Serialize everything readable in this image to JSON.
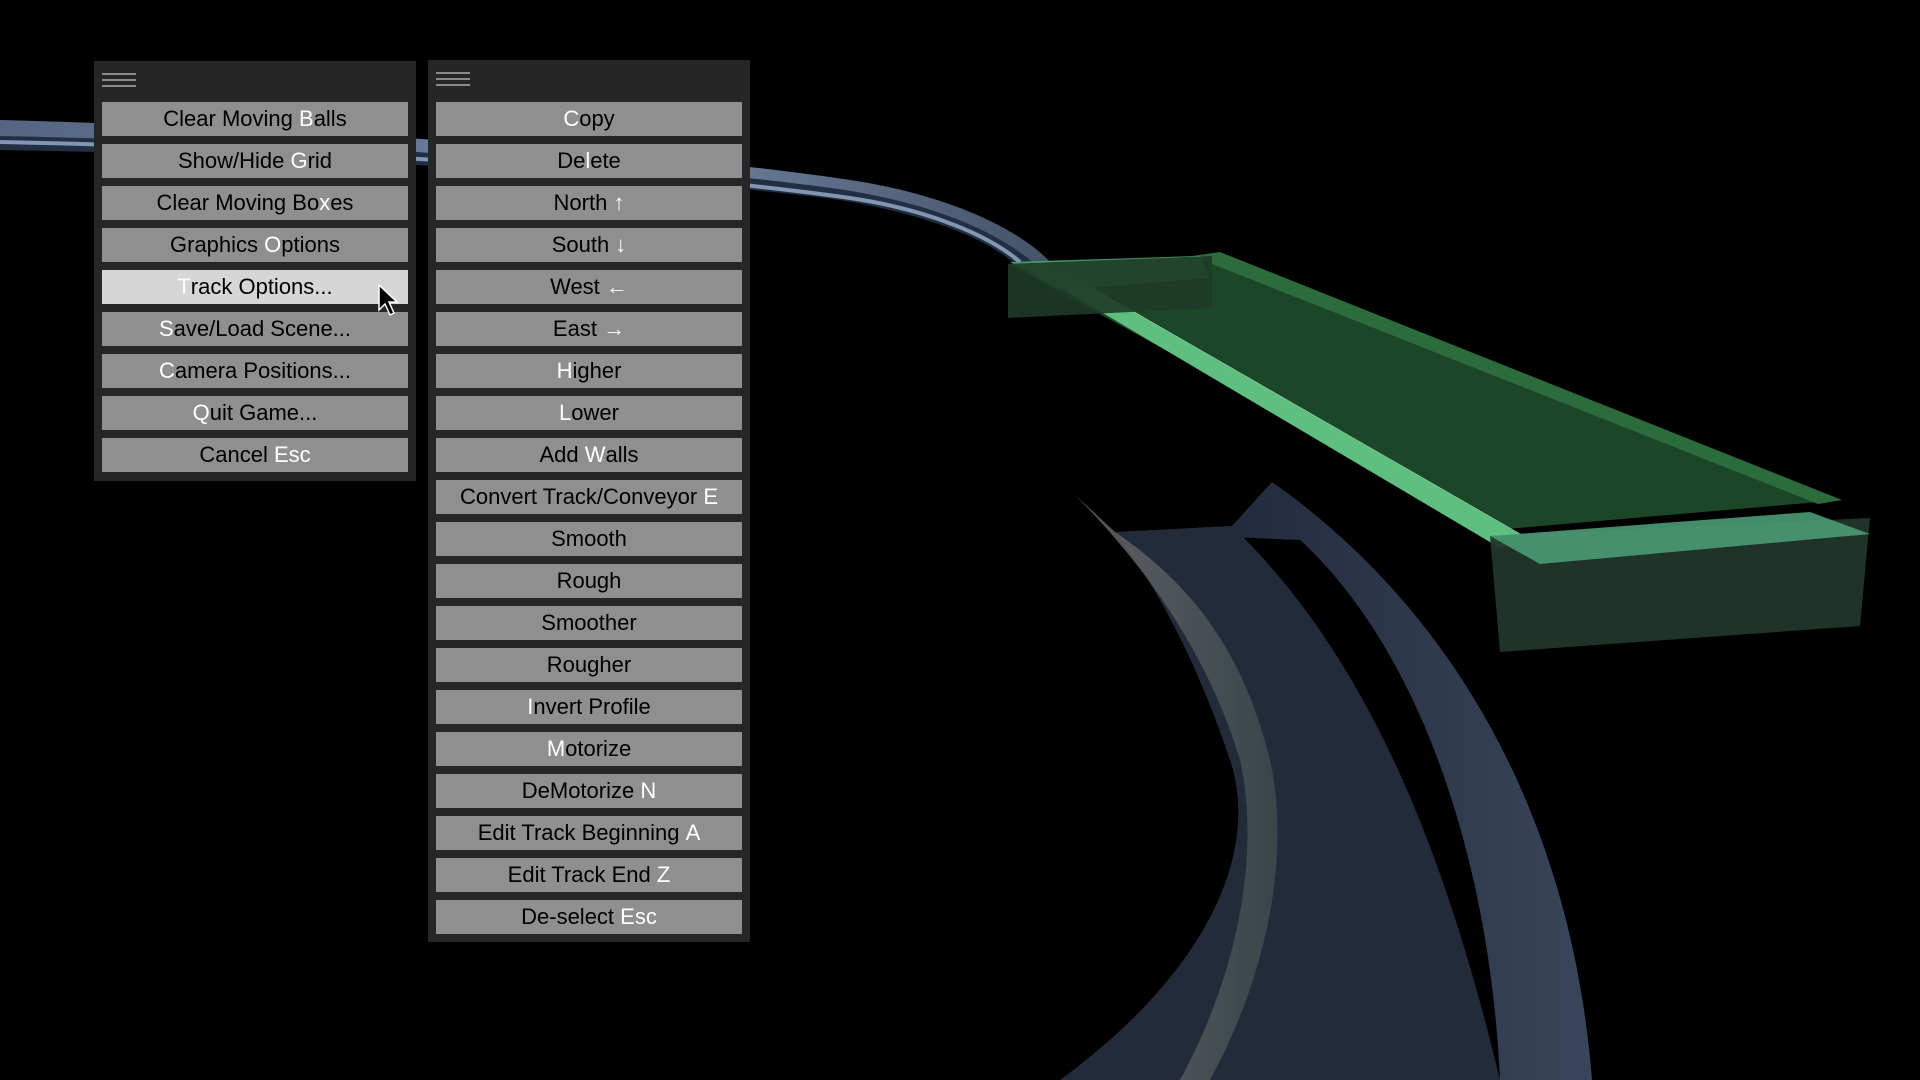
{
  "main_menu": {
    "items": [
      {
        "pre": "Clear Moving ",
        "key": "B",
        "post": "alls"
      },
      {
        "pre": "Show/Hide ",
        "key": "G",
        "post": "rid"
      },
      {
        "pre": "Clear Moving Bo",
        "key": "x",
        "post": "es"
      },
      {
        "pre": "Graphics ",
        "key": "O",
        "post": "ptions"
      },
      {
        "pre": "",
        "key": "T",
        "post": "rack Options..."
      },
      {
        "pre": "",
        "key": "S",
        "post": "ave/Load Scene..."
      },
      {
        "pre": "",
        "key": "C",
        "post": "amera Positions..."
      },
      {
        "pre": "",
        "key": "Q",
        "post": "uit Game..."
      },
      {
        "pre": "Cancel ",
        "key": "Esc",
        "post": ""
      }
    ],
    "highlighted_index": 4
  },
  "track_menu": {
    "items": [
      {
        "pre": "",
        "key": "C",
        "post": "opy"
      },
      {
        "pre": "De",
        "key": "l",
        "post": "ete"
      },
      {
        "pre": "North ",
        "key": "↑",
        "post": ""
      },
      {
        "pre": "South ",
        "key": "↓",
        "post": ""
      },
      {
        "pre": "West ",
        "key": "←",
        "post": ""
      },
      {
        "pre": "East ",
        "key": "→",
        "post": ""
      },
      {
        "pre": "",
        "key": "H",
        "post": "igher"
      },
      {
        "pre": "",
        "key": "L",
        "post": "ower"
      },
      {
        "pre": "Add ",
        "key": "W",
        "post": "alls"
      },
      {
        "pre": "Convert Track/Conveyor ",
        "key": "E",
        "post": ""
      },
      {
        "pre": "Smooth",
        "key": "",
        "post": ""
      },
      {
        "pre": "Rough",
        "key": "",
        "post": ""
      },
      {
        "pre": "Smoother",
        "key": "",
        "post": ""
      },
      {
        "pre": "Rougher",
        "key": "",
        "post": ""
      },
      {
        "pre": "",
        "key": "I",
        "post": "nvert Profile"
      },
      {
        "pre": "",
        "key": "M",
        "post": "otorize"
      },
      {
        "pre": "DeMotorize ",
        "key": "N",
        "post": ""
      },
      {
        "pre": "Edit Track Beginning ",
        "key": "A",
        "post": ""
      },
      {
        "pre": "Edit Track End ",
        "key": "Z",
        "post": ""
      },
      {
        "pre": "De-select ",
        "key": "Esc",
        "post": ""
      }
    ]
  },
  "icons": {
    "panel_grip": "drag-handle-icon",
    "cursor": "mouse-pointer-icon"
  },
  "colors": {
    "button_bg": "#8f8f8f",
    "button_highlight": "#d6d6d6",
    "panel_bg": "#262626",
    "hotkey_text": "#ffffff",
    "label_text": "#000000"
  }
}
